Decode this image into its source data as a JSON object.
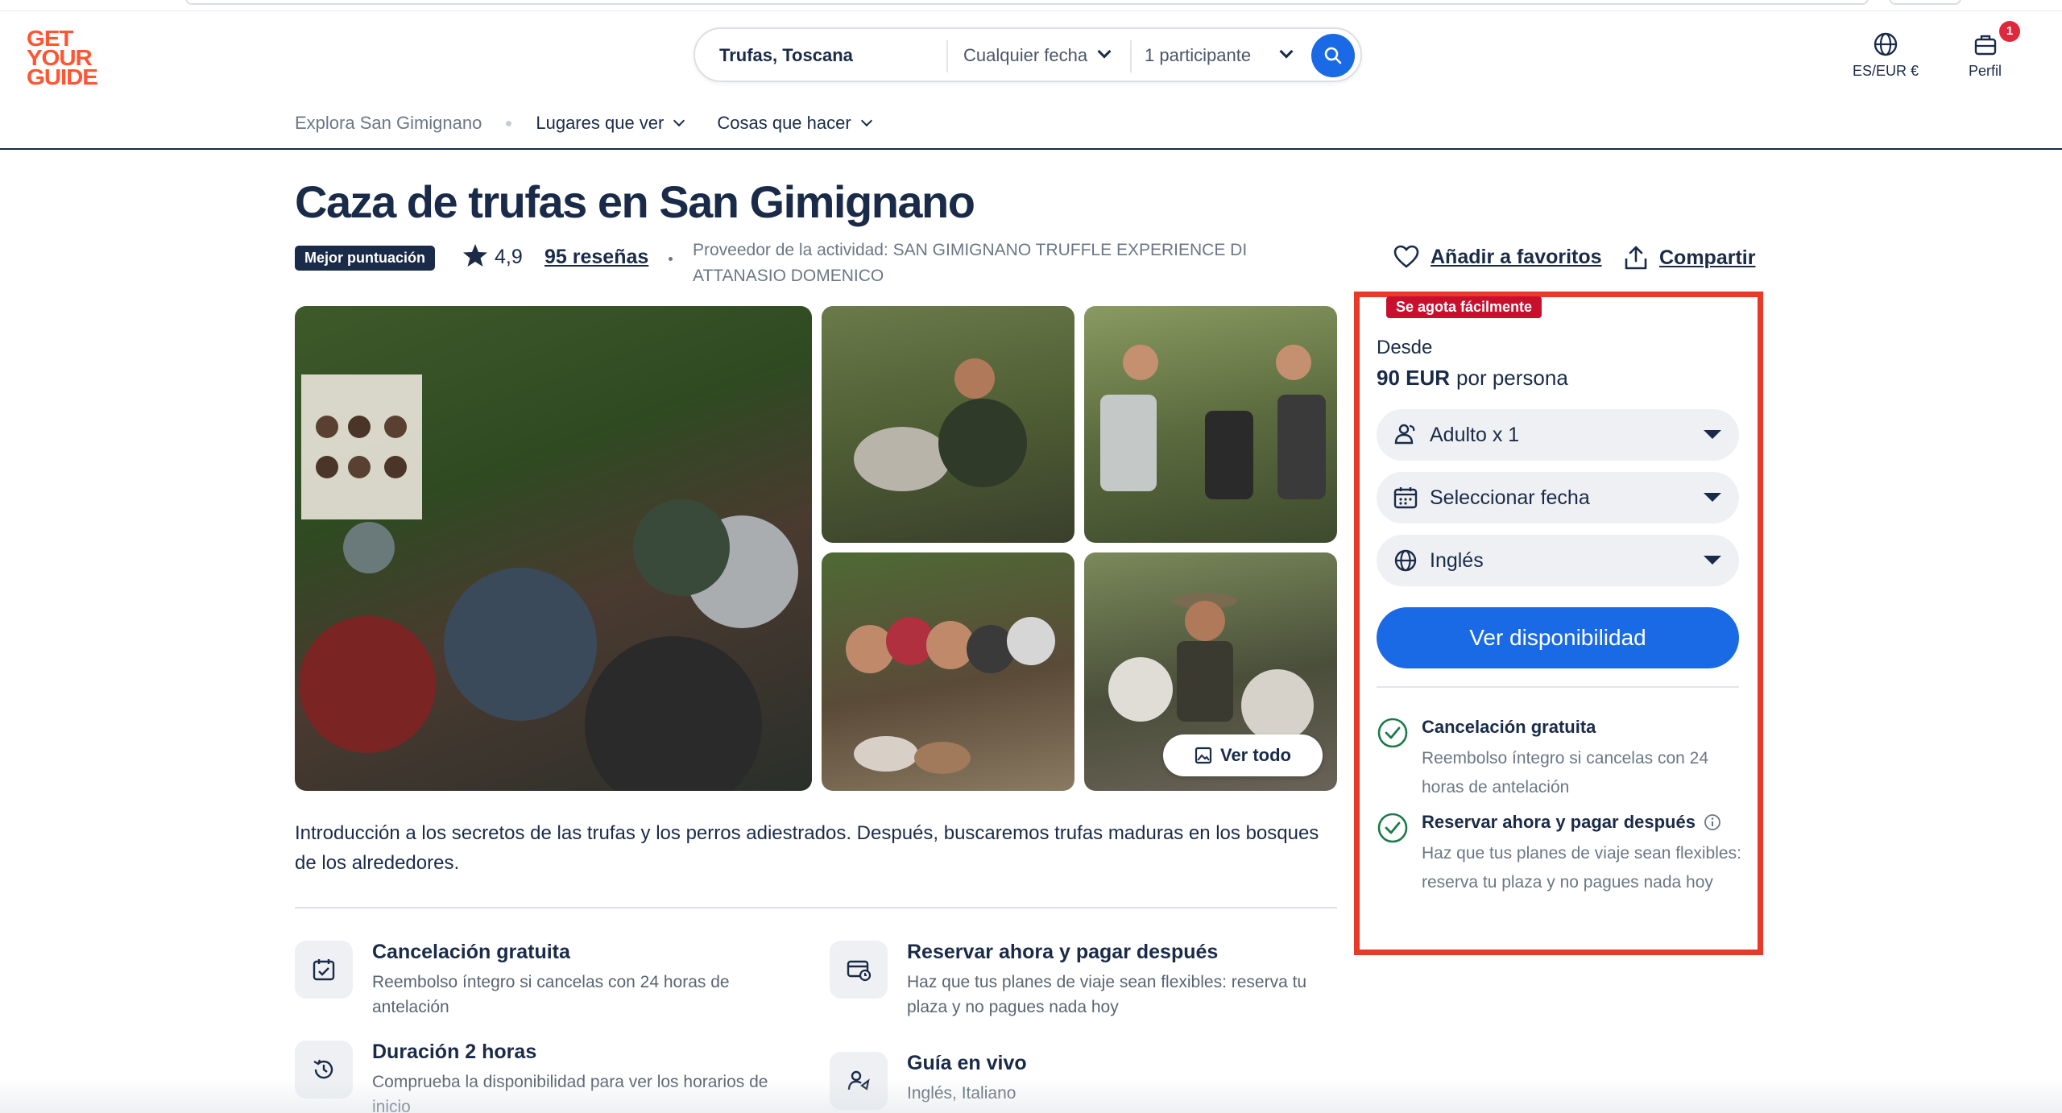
{
  "brand": {
    "logo_lines": [
      "GET",
      "YOUR",
      "GUIDE"
    ],
    "accent": "#ff5533",
    "primary": "#1a6ae6",
    "navy": "#1a2b49"
  },
  "search": {
    "query": "Trufas, Toscana",
    "date": "Cualquier fecha",
    "participants": "1 participante",
    "icon": "search-icon"
  },
  "header": {
    "locale": "ES/EUR €",
    "profile": "Perfil",
    "notification_count": "1"
  },
  "subnav": {
    "breadcrumb": "Explora San Gimignano",
    "items": [
      {
        "label": "Lugares que ver"
      },
      {
        "label": "Cosas que hacer"
      }
    ]
  },
  "activity": {
    "title": "Caza de trufas en San Gimignano",
    "badge": "Mejor puntuación",
    "rating": "4,9",
    "reviews": "95 reseñas",
    "provider": "Proveedor de la actividad: SAN GIMIGNANO TRUFFLE EXPERIENCE DI ATTANASIO DOMENICO",
    "favorite": "Añadir a favoritos",
    "share": "Compartir",
    "view_all": "Ver todo",
    "description": "Introducción a los secretos de las trufas y los perros adiestrados. Después, buscaremos trufas maduras en los bosques de los alrededores."
  },
  "features": [
    {
      "title": "Cancelación gratuita",
      "desc": "Reembolso íntegro si cancelas con 24 horas de antelación",
      "icon": "calendar-check-icon"
    },
    {
      "title": "Reservar ahora y pagar después",
      "desc": "Haz que tus planes de viaje sean flexibles: reserva tu plaza y no pagues nada hoy",
      "icon": "card-clock-icon"
    },
    {
      "title": "Duración 2 horas",
      "desc": "Comprueba la disponibilidad para ver los horarios de inicio",
      "icon": "history-clock-icon"
    },
    {
      "title": "Guía en vivo",
      "desc": "Inglés, Italiano",
      "icon": "guide-person-icon"
    }
  ],
  "booking": {
    "sellout": "Se agota fácilmente",
    "from": "Desde",
    "price": "90 EUR",
    "per": "por persona",
    "adults": "Adulto x 1",
    "date": "Seleccionar fecha",
    "language": "Inglés",
    "cta": "Ver disponibilidad",
    "perks": [
      {
        "title": "Cancelación gratuita",
        "desc": "Reembolso íntegro si cancelas con 24 horas de antelación"
      },
      {
        "title": "Reservar ahora y pagar después",
        "desc": "Haz que tus planes de viaje sean flexibles: reserva tu plaza y no pagues nada hoy"
      }
    ]
  }
}
